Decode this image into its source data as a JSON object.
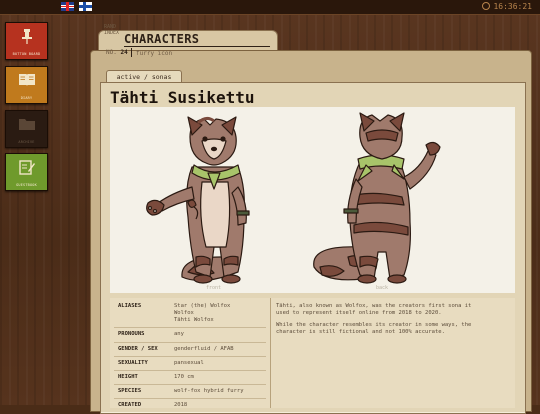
{
  "topbar": {
    "languages": [
      {
        "code": "en",
        "icon": "uk-flag-icon"
      },
      {
        "code": "fi",
        "icon": "finland-flag-icon"
      }
    ],
    "time": "16:36:21"
  },
  "sidebar": {
    "items": [
      {
        "label": "BUTTON BOARD",
        "icon": "pin-icon",
        "color": "#b6321f"
      },
      {
        "label": "DIARY",
        "icon": "book-icon",
        "color": "#c07a1d"
      },
      {
        "label": "ARCHIVE",
        "icon": "folder-icon",
        "color": "#2a1b12"
      },
      {
        "label": "GUESTBOOK",
        "icon": "note-pen-icon",
        "color": "#6f9a2c"
      }
    ]
  },
  "folder": {
    "small_label_1": "RAND",
    "small_label_2": "INDEX",
    "title": "CHARACTERS",
    "num_prefix": "NO.",
    "num": "24",
    "subtitle": "furry icon"
  },
  "card": {
    "tab": "active / sonas",
    "name": "Tähti Susikettu",
    "art_captions": {
      "front": "front",
      "back": "back"
    }
  },
  "info": {
    "rows": [
      {
        "key": "ALIASES",
        "value": "Star (the) Wolfox\nWolfox\nTähti Wolfox"
      },
      {
        "key": "PRONOUNS",
        "value": "any"
      },
      {
        "key": "GENDER / SEX",
        "value": "genderfluid / AFAB"
      },
      {
        "key": "SEXUALITY",
        "value": "pansexual"
      },
      {
        "key": "HEIGHT",
        "value": "170 cm"
      },
      {
        "key": "SPECIES",
        "value": "wolf-fox hybrid furry"
      },
      {
        "key": "CREATED",
        "value": "2018"
      }
    ],
    "description": [
      "Tähti, also known as Wolfox, was the creators first sona it used to represent itself online from 2018 to 2020.",
      "While the character resembles its creator in some ways, the character is still fictional and not 100% accurate."
    ]
  },
  "colors": {
    "wood": "#4b2c18",
    "folder": "#c8b38c",
    "card": "#e2d5b6",
    "fur_main": "#a07a6c",
    "fur_dark": "#7a4a3c",
    "fur_light": "#e8d2c2",
    "scarf": "#a8c46a"
  }
}
